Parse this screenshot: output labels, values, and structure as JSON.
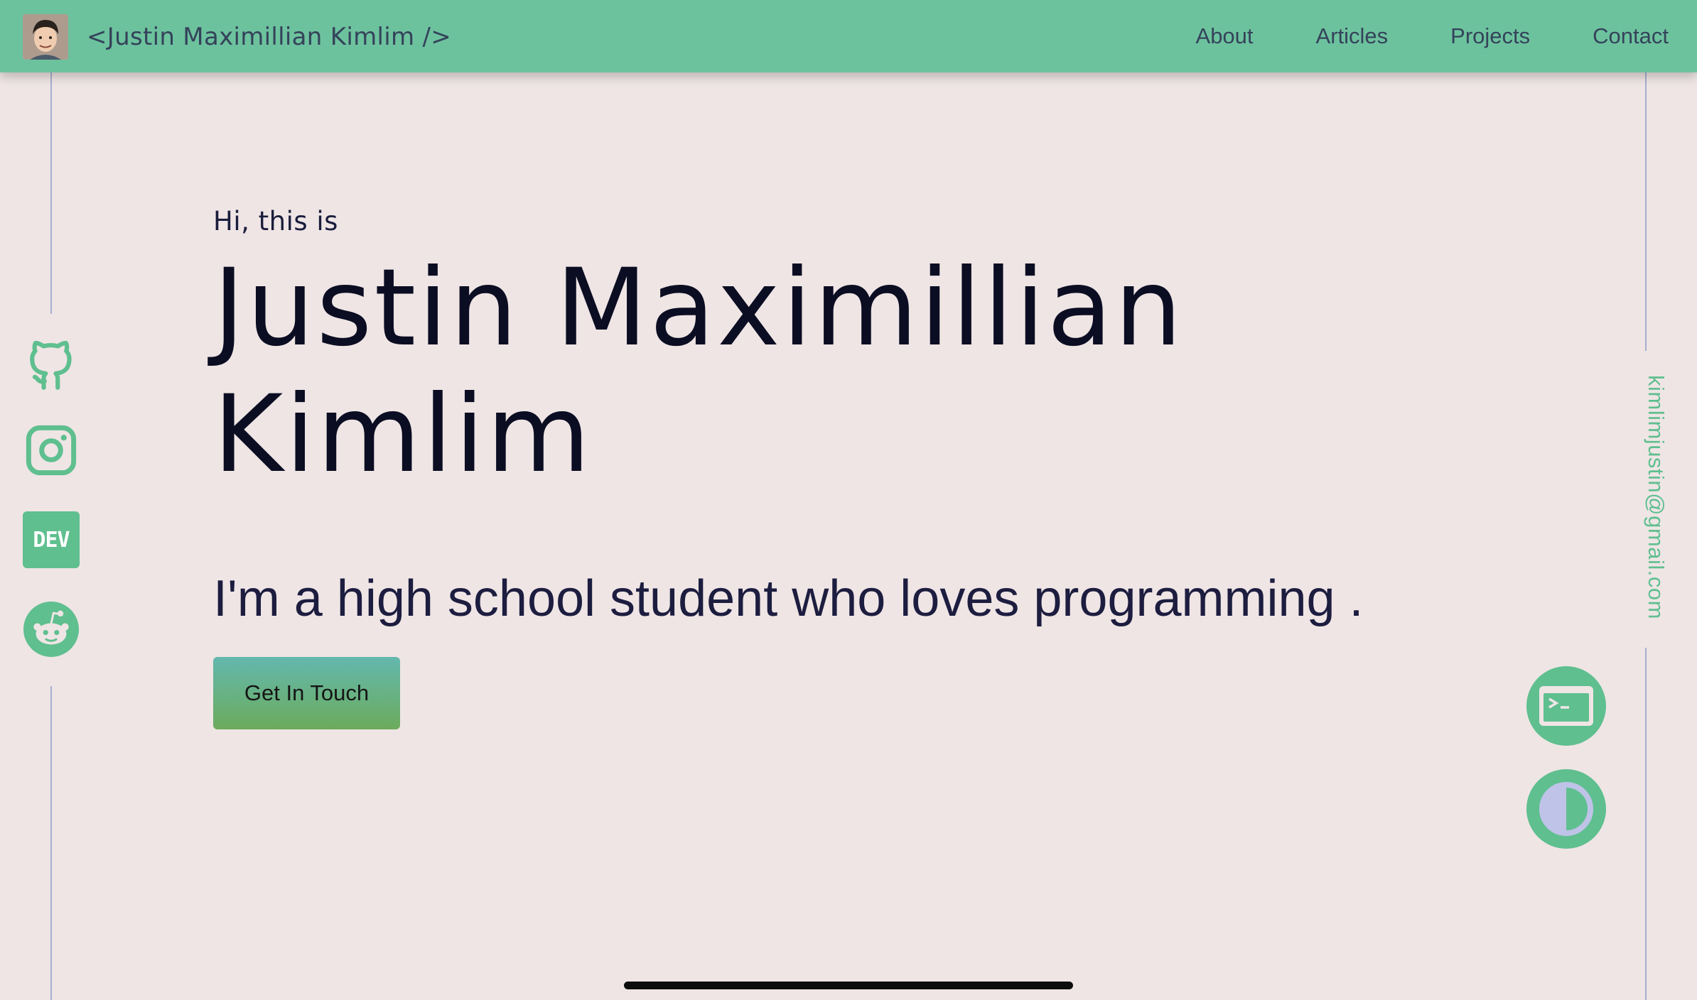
{
  "header": {
    "site_title": "<Justin Maximillian Kimlim />",
    "nav": [
      {
        "label": "About"
      },
      {
        "label": "Articles"
      },
      {
        "label": "Projects"
      },
      {
        "label": "Contact"
      }
    ]
  },
  "social": [
    {
      "icon": "github-icon"
    },
    {
      "icon": "instagram-icon"
    },
    {
      "icon": "dev-icon",
      "label": "DEV"
    },
    {
      "icon": "reddit-icon"
    }
  ],
  "email": "kimlimjustin@gmail.com",
  "hero": {
    "greeting": "Hi, this is",
    "name": "Justin Maximillian Kimlim",
    "tagline": "I'm a high school student who loves programming .",
    "cta_label": "Get In Touch"
  },
  "floating_buttons": [
    {
      "icon": "terminal-icon"
    },
    {
      "icon": "theme-toggle-icon"
    }
  ],
  "colors": {
    "background": "#efe5e5",
    "header": "#6dc29e",
    "accent": "#5fbf8f",
    "text_dark": "#0b0d22",
    "nav_text": "#34435a",
    "line": "#a7aed0",
    "toggle_fill": "#bfc3e8"
  }
}
